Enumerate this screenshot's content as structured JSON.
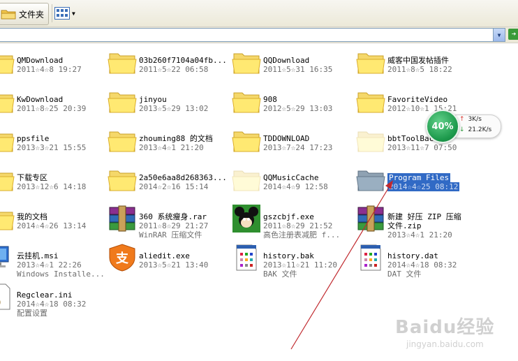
{
  "toolbar": {
    "folders_label": "文件夹"
  },
  "address": {
    "value": ""
  },
  "items": [
    {
      "name": "QMDownload",
      "meta": "2011☆4☆8 19:27",
      "type": "folder"
    },
    {
      "name": "03b260f7104a04fb...",
      "meta": "2011☆5☆22 06:58",
      "type": "folder"
    },
    {
      "name": "QQDownload",
      "meta": "2011☆5☆31 16:35",
      "type": "folder"
    },
    {
      "name": "威客中国发帖插件",
      "meta": "2011☆8☆5 18:22",
      "type": "folder"
    },
    {
      "name": "KwDownload",
      "meta": "2011☆8☆25 20:39",
      "type": "folder"
    },
    {
      "name": "jinyou",
      "meta": "2013☆5☆29 13:02",
      "type": "folder"
    },
    {
      "name": "908",
      "meta": "2012☆5☆29 13:03",
      "type": "folder"
    },
    {
      "name": "FavoriteVideo",
      "meta": "2012☆10☆1 15:21",
      "type": "folder"
    },
    {
      "name": "ppsfile",
      "meta": "2013☆3☆21 15:55",
      "type": "folder"
    },
    {
      "name": "zhouming88 的文档",
      "meta": "2013☆4☆1 21:20",
      "type": "folder"
    },
    {
      "name": "TDDOWNLOAD",
      "meta": "2013☆7☆24 17:23",
      "type": "folder"
    },
    {
      "name": "bbtToolBac",
      "meta": "2013☆11☆7 07:50",
      "type": "folder-faded"
    },
    {
      "name": "下载专区",
      "meta": "2013☆12☆6 14:18",
      "type": "folder"
    },
    {
      "name": "2a50e6aa8d268363...",
      "meta": "2014☆2☆16 15:14",
      "type": "folder"
    },
    {
      "name": "QQMusicCache",
      "meta": "2014☆4☆9 12:58",
      "type": "folder-faded"
    },
    {
      "name": "Program Files",
      "meta": "2014☆4☆25 08:12",
      "type": "folder-gray",
      "selected": true
    },
    {
      "name": "我的文档",
      "meta": "2014☆4☆26 13:14",
      "type": "folder"
    },
    {
      "name": "360 系统瘦身.rar",
      "meta": "2011☆8☆29 21:27",
      "meta2": "WinRAR 压缩文件",
      "type": "rar"
    },
    {
      "name": "gszcbjf.exe",
      "meta": "2011☆8☆29 21:52",
      "meta2": "高色注册表减肥 f...",
      "type": "mickey"
    },
    {
      "name": "新建 好压 ZIP 压缩",
      "name2": "文件.zip",
      "meta": "2013☆4☆1 21:20",
      "type": "zip"
    },
    {
      "name": "云挂机.msi",
      "meta": "2013☆4☆1 22:26",
      "meta2": "Windows Installe...",
      "type": "msi"
    },
    {
      "name": "aliedit.exe",
      "meta": "2013☆5☆21 13:40",
      "type": "alipay"
    },
    {
      "name": "history.bak",
      "meta": "2013☆11☆21 11:20",
      "meta2": "BAK 文件",
      "type": "doc"
    },
    {
      "name": "history.dat",
      "meta": "2014☆4☆18 08:32",
      "meta2": "DAT 文件",
      "type": "doc"
    },
    {
      "name": "Regclear.ini",
      "meta": "2014☆4☆18 08:32",
      "meta2": "配置设置",
      "type": "ini"
    }
  ],
  "speed_widget": {
    "percent": "40%",
    "up": "3K/s",
    "down": "21.2K/s"
  },
  "watermark": {
    "brand": "Baidu经验",
    "url": "jingyan.baidu.com"
  },
  "colors": {
    "selection": "#316ac5",
    "arrow": "#c0282d",
    "folder": "#f5d86a"
  }
}
